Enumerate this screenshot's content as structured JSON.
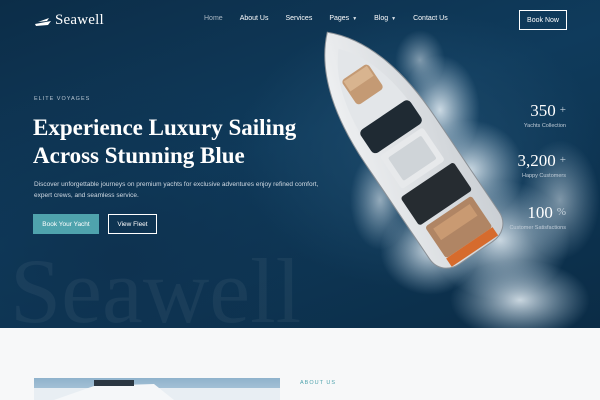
{
  "nav": {
    "logo_text": "Seawell",
    "items": [
      {
        "label": "Home",
        "active": true,
        "has_dropdown": false
      },
      {
        "label": "About Us",
        "active": false,
        "has_dropdown": false
      },
      {
        "label": "Services",
        "active": false,
        "has_dropdown": false
      },
      {
        "label": "Pages",
        "active": false,
        "has_dropdown": true
      },
      {
        "label": "Blog",
        "active": false,
        "has_dropdown": true
      },
      {
        "label": "Contact Us",
        "active": false,
        "has_dropdown": false
      }
    ],
    "cta": "Book Now"
  },
  "hero": {
    "eyebrow": "ELITE VOYAGES",
    "headline_line1": "Experience Luxury Sailing",
    "headline_line2": "Across Stunning Blue",
    "description": "Discover unforgettable journeys on premium yachts for exclusive adventures enjoy refined comfort, expert crews, and seamless service.",
    "primary_button": "Book Your Yacht",
    "secondary_button": "View Fleet",
    "watermark": "Seawell"
  },
  "stats": [
    {
      "value": "350",
      "suffix": "+",
      "label": "Yachts Collection"
    },
    {
      "value": "3,200",
      "suffix": "+",
      "label": "Happy Customers"
    },
    {
      "value": "100",
      "suffix": "%",
      "label": "Customer Satisfactions"
    }
  ],
  "about": {
    "label": "ABOUT US"
  },
  "colors": {
    "accent": "#4fa3ad",
    "ocean_dark": "#0c2d48",
    "section_bg": "#f7f8f9"
  },
  "icons": {
    "chevron": "chevron-down-icon",
    "logo": "sail-logo-icon"
  }
}
